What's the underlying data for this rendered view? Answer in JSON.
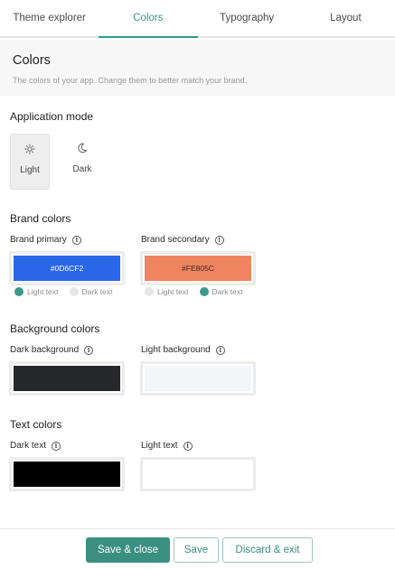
{
  "tabs": [
    {
      "label": "Theme explorer"
    },
    {
      "label": "Colors"
    },
    {
      "label": "Typography"
    },
    {
      "label": "Layout"
    }
  ],
  "active_tab": "Colors",
  "header": {
    "title": "Colors",
    "subtitle": "The colors of your app. Change them to better match your brand."
  },
  "application_mode": {
    "title": "Application mode",
    "options": [
      {
        "label": "Light",
        "icon": "sun-icon",
        "selected": true
      },
      {
        "label": "Dark",
        "icon": "moon-icon",
        "selected": false
      }
    ]
  },
  "brand_colors": {
    "title": "Brand colors",
    "primary": {
      "label": "Brand primary",
      "value": "#0D6CF2",
      "color": "#2a66e8",
      "text_color": "#ffffff"
    },
    "secondary": {
      "label": "Brand secondary",
      "value": "#FE805C",
      "color": "#ef8560",
      "text_color": "#3a2a22"
    },
    "light_text_label": "Light text",
    "dark_text_label": "Dark text",
    "primary_text_mode": "light",
    "secondary_text_mode": "dark"
  },
  "background_colors": {
    "title": "Background colors",
    "dark": {
      "label": "Dark background",
      "color": "#25272b"
    },
    "light": {
      "label": "Light background",
      "color": "#f3f5f9"
    }
  },
  "text_colors": {
    "title": "Text colors",
    "dark": {
      "label": "Dark text",
      "color": "#000000"
    },
    "light": {
      "label": "Light text",
      "color": "#ffffff"
    }
  },
  "footer": {
    "save_close_label": "Save & close",
    "save_label": "Save",
    "discard_label": "Discard & exit"
  },
  "colors": {
    "accent": "#2f9a8a",
    "radio_on": "#3a9a8a",
    "radio_off": "#e6e6e6"
  }
}
